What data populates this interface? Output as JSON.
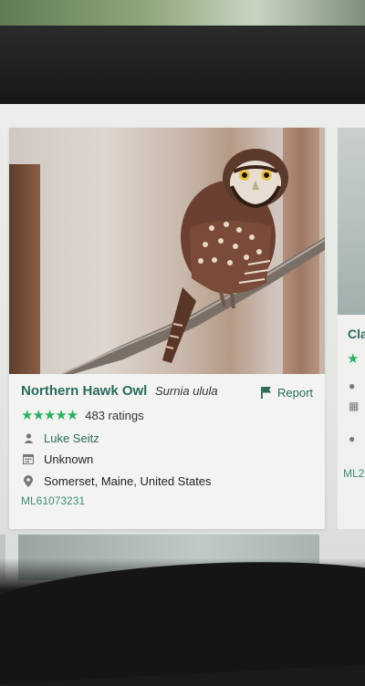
{
  "card": {
    "common_name": "Northern Hawk Owl",
    "scientific_name": "Surnia ulula",
    "report_label": "Report",
    "stars": "★★★★★",
    "rating_count": "483 ratings",
    "observer": "Luke Seitz",
    "date": "Unknown",
    "location": "Somerset, Maine, United States",
    "catalog_id": "ML61073231",
    "rating": 5,
    "rating_max": 5
  },
  "next_card": {
    "title_partial": "Cla",
    "star": "★",
    "catalog_partial": "ML2"
  },
  "icons": {
    "report": "flag-icon",
    "observer": "person-icon",
    "date": "calendar-icon",
    "location": "pin-icon"
  },
  "colors": {
    "accent_green": "#2a6b5a",
    "star_green": "#27b25f",
    "card_background": "#f3f4f2"
  }
}
